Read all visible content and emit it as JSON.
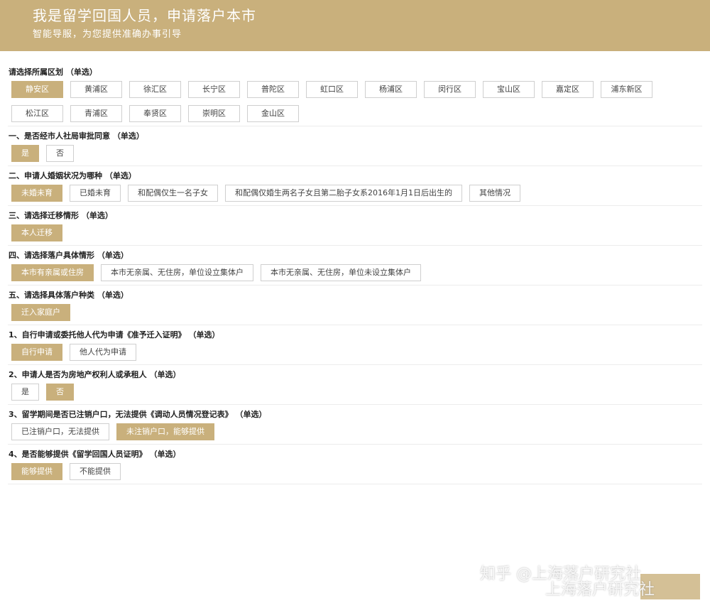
{
  "header": {
    "title": "我是留学回国人员，申请落户本市",
    "subtitle": "智能导服，为您提供准确办事引导"
  },
  "sections": [
    {
      "label": "请选择所属区划 （单选）",
      "options": [
        "静安区",
        "黄浦区",
        "徐汇区",
        "长宁区",
        "普陀区",
        "虹口区",
        "杨浦区",
        "闵行区",
        "宝山区",
        "嘉定区",
        "浦东新区",
        "松江区",
        "青浦区",
        "奉贤区",
        "崇明区",
        "金山区"
      ],
      "selected": 0
    },
    {
      "label": "一、是否经市人社局审批同意 （单选）",
      "options": [
        "是",
        "否"
      ],
      "selected": 0
    },
    {
      "label": "二、申请人婚姻状况为哪种 （单选）",
      "options": [
        "未婚未育",
        "已婚未育",
        "和配偶仅生一名子女",
        "和配偶仅婚生两名子女且第二胎子女系2016年1月1日后出生的",
        "其他情况"
      ],
      "selected": 0
    },
    {
      "label": "三、请选择迁移情形 （单选）",
      "options": [
        "本人迁移"
      ],
      "selected": 0
    },
    {
      "label": "四、请选择落户具体情形 （单选）",
      "options": [
        "本市有亲属或住房",
        "本市无亲属、无住房，单位设立集体户",
        "本市无亲属、无住房，单位未设立集体户"
      ],
      "selected": 0
    },
    {
      "label": "五、请选择具体落户种类 （单选）",
      "options": [
        "迁入家庭户"
      ],
      "selected": 0
    },
    {
      "label": "1、自行申请或委托他人代为申请《准予迁入证明》 （单选）",
      "options": [
        "自行申请",
        "他人代为申请"
      ],
      "selected": 0
    },
    {
      "label": "2、申请人是否为房地产权利人或承租人 （单选）",
      "options": [
        "是",
        "否"
      ],
      "selected": 1
    },
    {
      "label": "3、留学期间是否已注销户口，无法提供《调动人员情况登记表》 （单选）",
      "options": [
        "已注销户口，无法提供",
        "未注销户口，能够提供"
      ],
      "selected": 1
    },
    {
      "label": "4、是否能够提供《留学回国人员证明》 （单选）",
      "options": [
        "能够提供",
        "不能提供"
      ],
      "selected": 0
    }
  ],
  "watermark": {
    "line1": "知乎 @上海落户研究社",
    "line2": "上海落户研究社"
  },
  "colors": {
    "accent": "#c9b07c",
    "border": "#cfcfcf"
  }
}
